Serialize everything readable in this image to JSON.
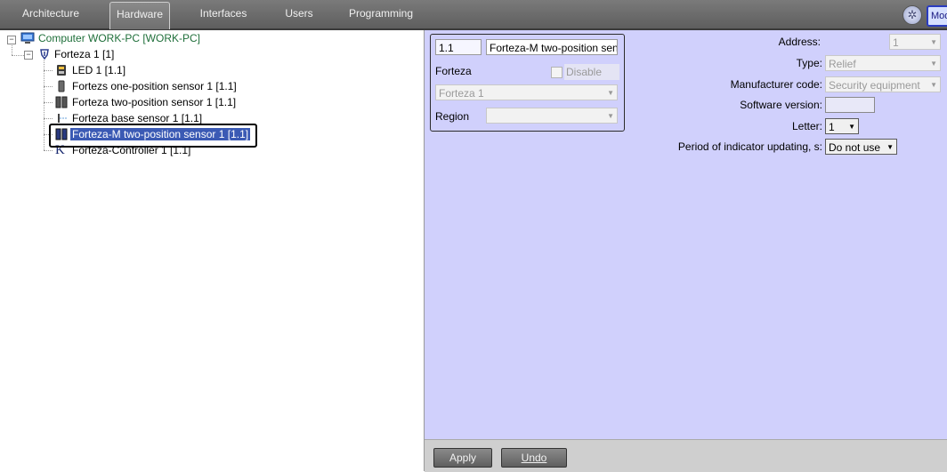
{
  "tabs": [
    {
      "label": "Architecture"
    },
    {
      "label": "Hardware",
      "active": true
    },
    {
      "label": "Interfaces"
    },
    {
      "label": "Users"
    },
    {
      "label": "Programming"
    }
  ],
  "top_right": {
    "mode_label": "Mod",
    "settings_icon": "gear-icon"
  },
  "tree": {
    "computer": "Computer WORK-PC [WORK-PC]",
    "forteza": "Forteza 1 [1]",
    "children": [
      {
        "label": "LED 1 [1.1]",
        "icon": "led-icon"
      },
      {
        "label": "Fortezs one-position sensor 1 [1.1]",
        "icon": "one-position-sensor-icon"
      },
      {
        "label": "Forteza two-position sensor 1 [1.1]",
        "icon": "two-position-sensor-icon"
      },
      {
        "label": "Forteza base sensor 1 [1.1]",
        "icon": "base-sensor-icon"
      },
      {
        "label": "Forteza-M two-position sensor 1 [1.1]",
        "icon": "two-position-sensor-icon",
        "selected": true
      },
      {
        "label": "Forteza-Controller 1 [1.1]",
        "icon": "controller-icon"
      }
    ]
  },
  "object_box": {
    "id_value": "1.1",
    "name_value": "Forteza-M two-position sensor",
    "parent_label": "Forteza",
    "disable_label": "Disable",
    "parent_value": "Forteza 1",
    "region_label": "Region",
    "region_value": ""
  },
  "props": {
    "address_label": "Address:",
    "address_value": "1",
    "type_label": "Type:",
    "type_value": "Relief",
    "manufacturer_label": "Manufacturer code:",
    "manufacturer_value": "Security equipment",
    "software_label": "Software version:",
    "software_value": "",
    "letter_label": "Letter:",
    "letter_value": "1",
    "period_label": "Period of indicator updating, s:",
    "period_value": "Do not use"
  },
  "buttons": {
    "apply": "Apply",
    "undo": "Undo"
  }
}
